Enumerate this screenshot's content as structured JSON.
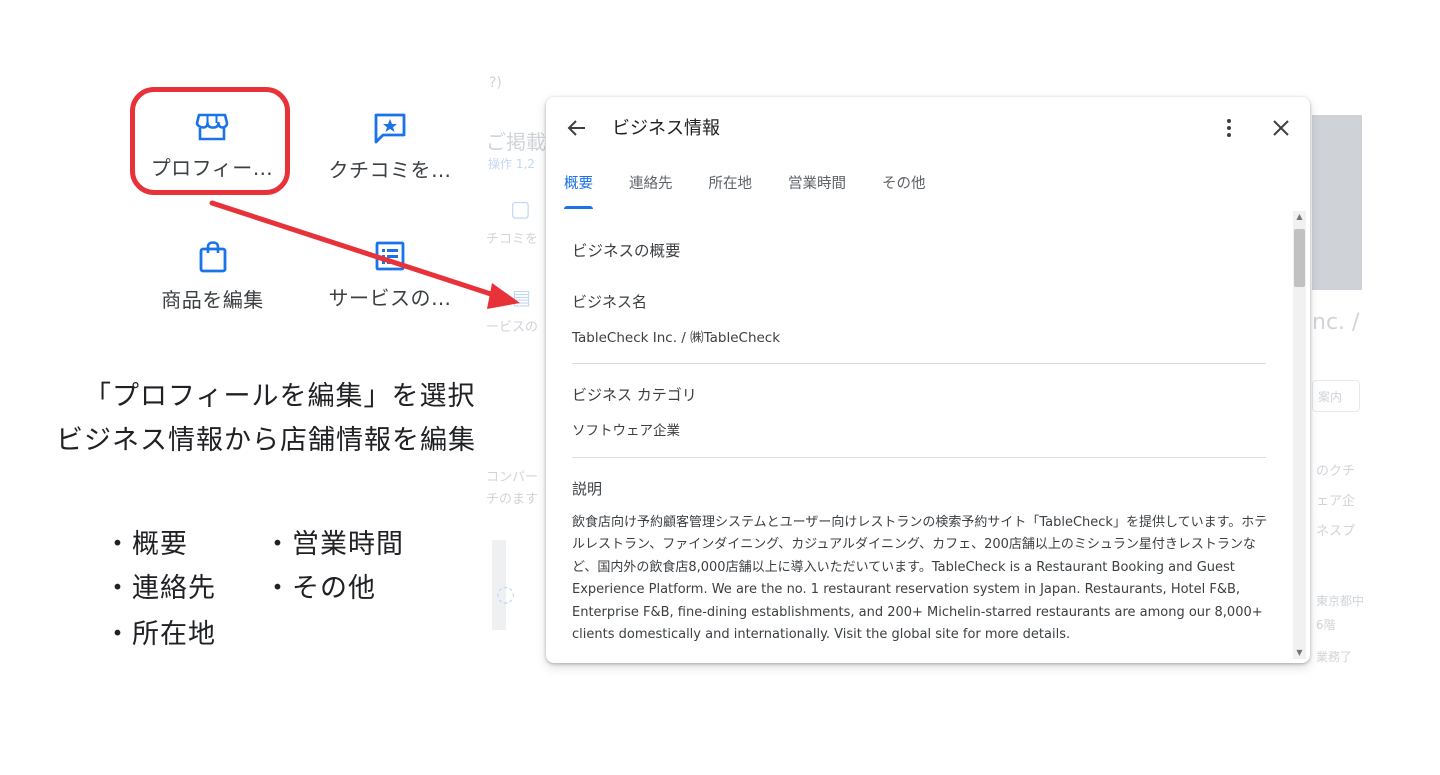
{
  "left": {
    "tiles": {
      "profile": "プロフィー…",
      "reviews": "クチコミを…",
      "products": "商品を編集",
      "services": "サービスの…"
    },
    "caption_line1": "「プロフィールを編集」を選択",
    "caption_line2": "ビジネス情報から店舗情報を編集",
    "bullets": [
      "・概要",
      "・連絡先",
      "・所在地",
      "・営業時間",
      "・その他"
    ]
  },
  "background": {
    "fragment_1": "ご掲載",
    "fragment_2": "操作 1,2",
    "fragment_3": "チコミを",
    "fragment_4": "ービスの",
    "fragment_5": "コンパー",
    "fragment_6": "チのます",
    "fragment_right_1": "nc. /",
    "fragment_right_2": "案内",
    "fragment_right_3": "のクチ",
    "fragment_right_4": "ェア企",
    "fragment_right_5": "ネスプ",
    "fragment_right_6": "東京都中",
    "fragment_right_7": "6階",
    "fragment_right_8": "業務了"
  },
  "dialog": {
    "title": "ビジネス情報",
    "tabs": [
      "概要",
      "連絡先",
      "所在地",
      "営業時間",
      "その他"
    ],
    "active_tab": "概要",
    "section_title": "ビジネスの概要",
    "name_label": "ビジネス名",
    "name_value": "TableCheck Inc. / ㈱TableCheck",
    "category_label": "ビジネス カテゴリ",
    "category_value": "ソフトウェア企業",
    "description_label": "説明",
    "description_text": "飲食店向け予約顧客管理システムとユーザー向けレストランの検索予約サイト「TableCheck」を提供しています。ホテルレストラン、ファインダイニング、カジュアルダイニング、カフェ、200店舗以上のミシュラン星付きレストランなど、国内外の飲食店8,000店舗以上に導入いただいています。TableCheck is a Restaurant Booking and Guest Experience Platform. We are the no. 1 restaurant reservation system in Japan. Restaurants, Hotel F&B, Enterprise F&B, fine-dining establishments, and 200+ Michelin-starred restaurants are among our 8,000+ clients domestically and internationally. Visit the global site for more details."
  },
  "colors": {
    "accent": "#1a73e8",
    "highlight": "#e8323a"
  }
}
